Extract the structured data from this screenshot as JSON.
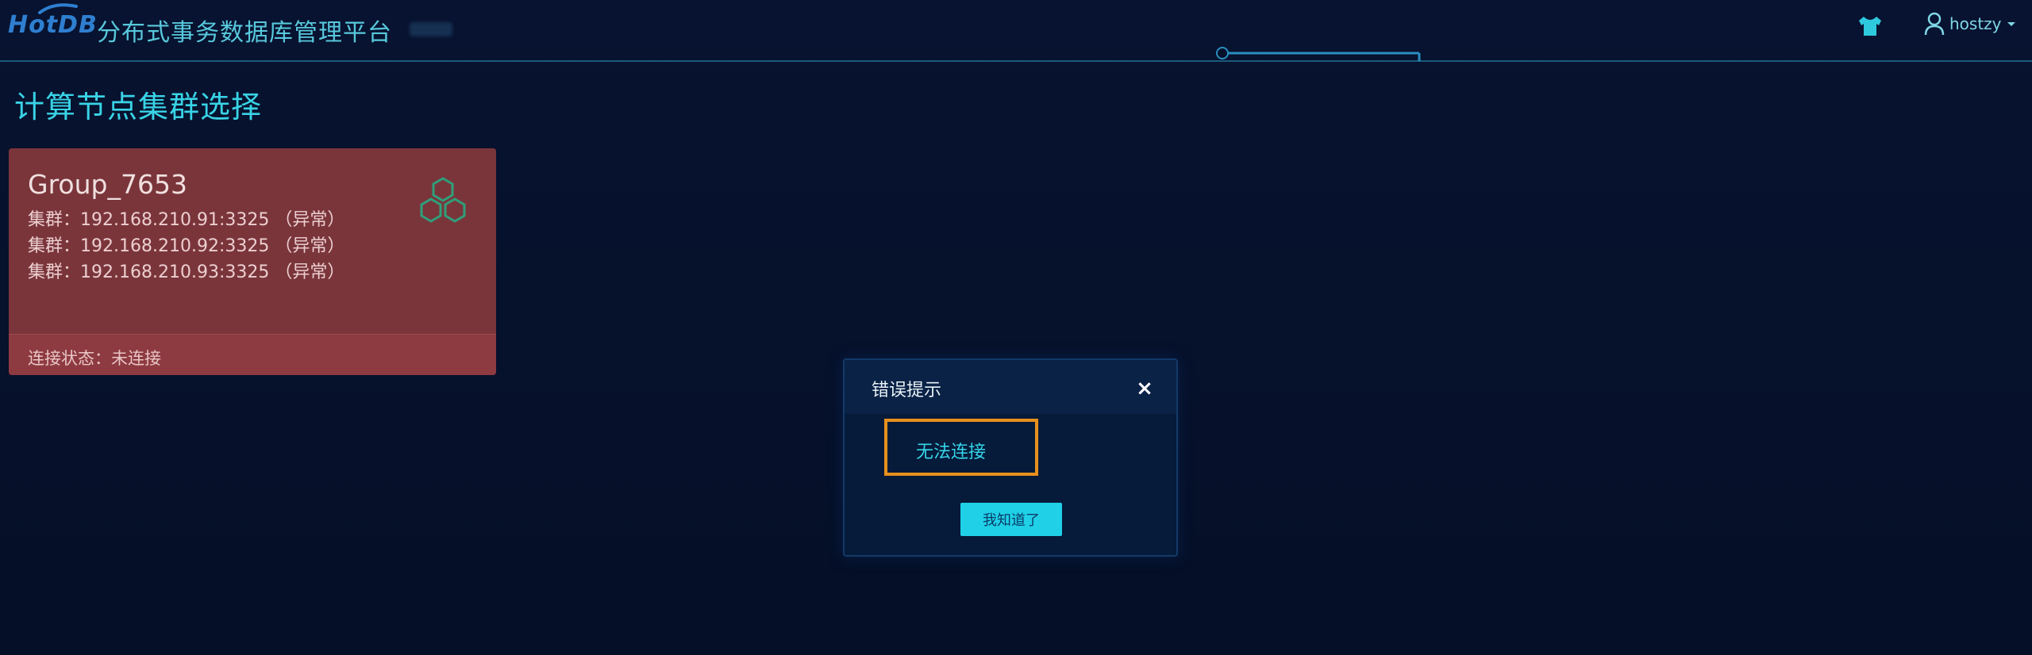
{
  "header": {
    "logo_text": "HotDB",
    "app_title": "分布式事务数据库管理平台",
    "user_name": "hostzy"
  },
  "page": {
    "title": "计算节点集群选择"
  },
  "cards": [
    {
      "name": "Group_7653",
      "clusters": [
        "集群：192.168.210.91:3325 （异常）",
        "集群：192.168.210.92:3325 （异常）",
        "集群：192.168.210.93:3325 （异常）"
      ],
      "status": "连接状态：未连接"
    }
  ],
  "modal": {
    "title": "错误提示",
    "close_label": "×",
    "message": "无法连接",
    "ok_label": "我知道了"
  },
  "icons": {
    "theme": "tshirt-icon",
    "user": "user-icon",
    "dropdown": "caret-down-icon",
    "cluster": "hexagon-cluster-icon"
  },
  "colors": {
    "background": "#06102a",
    "accent": "#39d3e6",
    "card_error": "#7e363d",
    "modal_border_highlight": "#e8901c",
    "button": "#1fd0e6"
  }
}
